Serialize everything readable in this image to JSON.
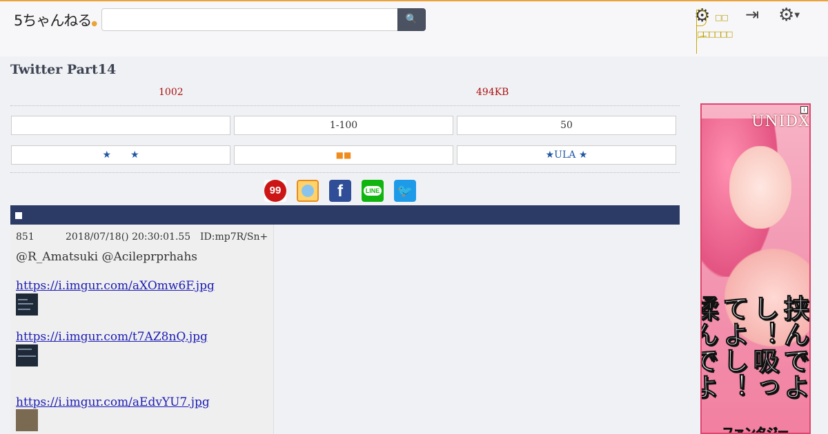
{
  "header": {
    "logo_text": "5ちゃんねる",
    "search_placeholder": "",
    "search_icon": "search-icon",
    "tooltip_top": "□□",
    "tooltip_bottom": "□□□□□□"
  },
  "thread": {
    "title": "Twitter Part14",
    "post_count": "1002",
    "size": "494KB"
  },
  "nav_row1": [
    "",
    "1-100",
    "50"
  ],
  "nav_row2": {
    "left": "★　　★",
    "middle": "■■",
    "right": "★ULA ★"
  },
  "share": {
    "s99": "99",
    "facebook": "f",
    "line": "LINE",
    "twitter": "🐦"
  },
  "section": {
    "marker": "■"
  },
  "post": {
    "number": "851",
    "date": "2018/07/18() 20:30:01.55",
    "id": "ID:mp7R/Sn+",
    "body": "@R_Amatsuki @Acileprprhahs",
    "links": [
      "https://i.imgur.com/aXOmw6F.jpg",
      "https://i.imgur.com/t7AZ8nQ.jpg",
      "https://i.imgur.com/aEdvYU7.jpg"
    ]
  },
  "ad": {
    "logo": "UNIDX",
    "info": "i",
    "headline": "挟んでよし！吸ってよし！揉んでよし！",
    "bottom": "ファンタジー"
  },
  "colors": {
    "accent": "#e9a33a",
    "section_bar": "#2c3a66",
    "link": "#1b1bb5",
    "meta_red": "#aa1111"
  }
}
